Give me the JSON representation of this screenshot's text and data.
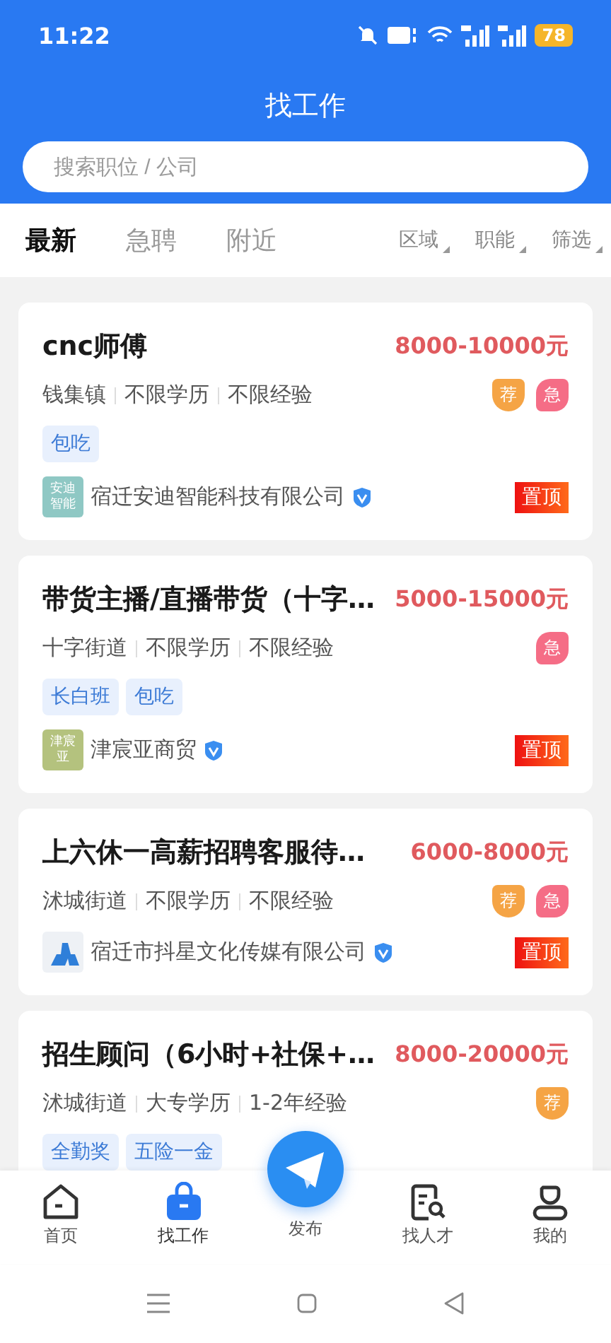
{
  "status_bar": {
    "time": "11:22",
    "battery": "78"
  },
  "header": {
    "title": "找工作",
    "search": {
      "placeholder": "搜索职位 / 公司"
    }
  },
  "tabs": [
    {
      "label": "最新",
      "selected": true
    },
    {
      "label": "急聘",
      "selected": false
    },
    {
      "label": "附近",
      "selected": false
    }
  ],
  "filters": [
    "区域",
    "职能",
    "筛选"
  ],
  "jobs": [
    {
      "title": "cnc师傅",
      "salary": "8000-10000元",
      "meta": [
        "钱集镇",
        "不限学历",
        "不限经验"
      ],
      "badges": [
        {
          "kind": "recommend",
          "label": "荐"
        },
        {
          "kind": "urgent",
          "label": "急"
        }
      ],
      "tags": [
        "包吃"
      ],
      "company": {
        "logo": {
          "kind": "text",
          "text": "安迪智能",
          "color": "#8fc8c4"
        },
        "name": "宿迁安迪智能科技有限公司",
        "verified": true
      },
      "pinned": {
        "label": "置顶"
      }
    },
    {
      "title": "带货主播/直播带货（十字…",
      "salary": "5000-15000元",
      "meta": [
        "十字街道",
        "不限学历",
        "不限经验"
      ],
      "badges": [
        {
          "kind": "urgent",
          "label": "急"
        }
      ],
      "tags": [
        "长白班",
        "包吃"
      ],
      "company": {
        "logo": {
          "kind": "text",
          "text": "津宸亚",
          "color": "#b4c27e"
        },
        "name": "津宸亚商贸",
        "verified": true
      },
      "pinned": {
        "label": "置顶"
      }
    },
    {
      "title": "上六休一高薪招聘客服待…",
      "salary": "6000-8000元",
      "meta": [
        "沭城街道",
        "不限学历",
        "不限经验"
      ],
      "badges": [
        {
          "kind": "recommend",
          "label": "荐"
        },
        {
          "kind": "urgent",
          "label": "急"
        }
      ],
      "company": {
        "logo": {
          "kind": "icon"
        },
        "name": "宿迁市抖星文化传媒有限公司",
        "verified": true
      },
      "pinned": {
        "label": "置顶"
      }
    },
    {
      "title": "招生顾问（6小时+社保+…",
      "salary": "8000-20000元",
      "meta": [
        "沭城街道",
        "大专学历",
        "1-2年经验"
      ],
      "badges": [
        {
          "kind": "recommend",
          "label": "荐"
        }
      ],
      "tags": [
        "全勤奖",
        "五险一金"
      ]
    }
  ],
  "bottom_nav": [
    {
      "kind": "home",
      "label": "首页",
      "selected": false
    },
    {
      "kind": "jobs",
      "label": "找工作",
      "selected": true
    },
    {
      "kind": "publish",
      "label": "发布",
      "selected": false
    },
    {
      "kind": "talent",
      "label": "找人才",
      "selected": false
    },
    {
      "kind": "me",
      "label": "我的",
      "selected": false
    }
  ]
}
